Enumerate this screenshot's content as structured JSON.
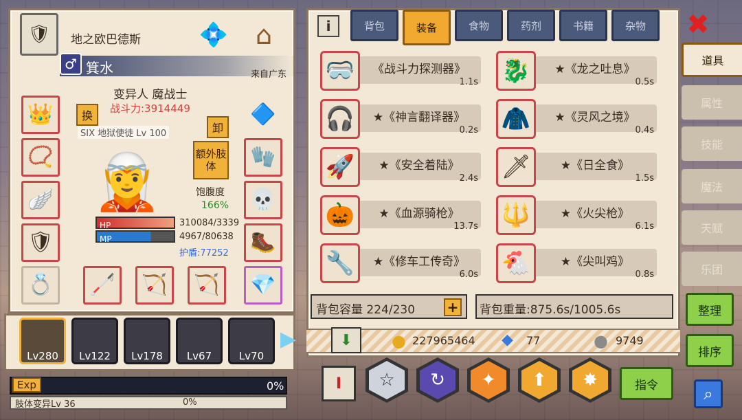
{
  "player": {
    "guild_title": "地之欧巴德斯",
    "name": "箕水",
    "location": "来自广东",
    "race_class": "变异人 魔战士",
    "power": "战斗力:3914449",
    "hp_text": "310084/3339",
    "mp_text": "4967/80638",
    "shield_text": "护盾:77252",
    "hp_label": "HP",
    "mp_label": "MP",
    "hunger_label": "饱腹度",
    "hunger_value": "166%",
    "sub_overlay": "SIX 地狱使徒 Lv 100"
  },
  "left_buttons": {
    "swap": "换",
    "unequip": "卸",
    "extra_limb": "额外肢体"
  },
  "team": [
    {
      "level": "Lv280"
    },
    {
      "level": "Lv122"
    },
    {
      "level": "Lv178"
    },
    {
      "level": "Lv67"
    },
    {
      "level": "Lv70"
    }
  ],
  "exp": {
    "label": "Exp",
    "value": "0%",
    "mutation_label": "肢体变异Lv 36",
    "mutation_value": "0%"
  },
  "tabs": [
    "背包",
    "装备",
    "食物",
    "药剂",
    "书籍",
    "杂物"
  ],
  "items_left": [
    {
      "name": "《战斗力探测器》",
      "time": "1.1s",
      "icon": "goggles-icon"
    },
    {
      "name": "★《神言翻译器》",
      "time": "0.2s",
      "icon": "headset-icon"
    },
    {
      "name": "★《安全着陆》",
      "time": "2.4s",
      "icon": "jetpack-icon"
    },
    {
      "name": "★《血源骑枪》",
      "time": "13.7s",
      "icon": "pumpkin-lance-icon"
    },
    {
      "name": "★《修车工传奇》",
      "time": "6.0s",
      "icon": "wrench-icon"
    }
  ],
  "items_right": [
    {
      "name": "★《龙之吐息》",
      "time": "0.5s",
      "icon": "dragon-head-icon"
    },
    {
      "name": "★《灵风之境》",
      "time": "0.4s",
      "icon": "red-armor-icon"
    },
    {
      "name": "★《日全食》",
      "time": "1.5s",
      "icon": "dark-sword-icon"
    },
    {
      "name": "★《火尖枪》",
      "time": "6.1s",
      "icon": "fire-spear-icon"
    },
    {
      "name": "★《尖叫鸡》",
      "time": "0.8s",
      "icon": "rubber-chicken-icon"
    }
  ],
  "capacity": "背包容量 224/230",
  "weight": "背包重量:875.6s/1005.6s",
  "currency": {
    "gold": "227965464",
    "diamond": "77",
    "silver": "9749"
  },
  "side_tabs": [
    "道具",
    "属性",
    "技能",
    "魔法",
    "天赋",
    "乐团"
  ],
  "actions": {
    "organize": "整理",
    "sort": "排序",
    "command": "指令"
  },
  "colors": {
    "panel": "#f2e8d5",
    "accent": "#f2a92f",
    "tab": "#4b5a7a",
    "item_border": "#c7464a",
    "green_button": "#8fd04a"
  }
}
